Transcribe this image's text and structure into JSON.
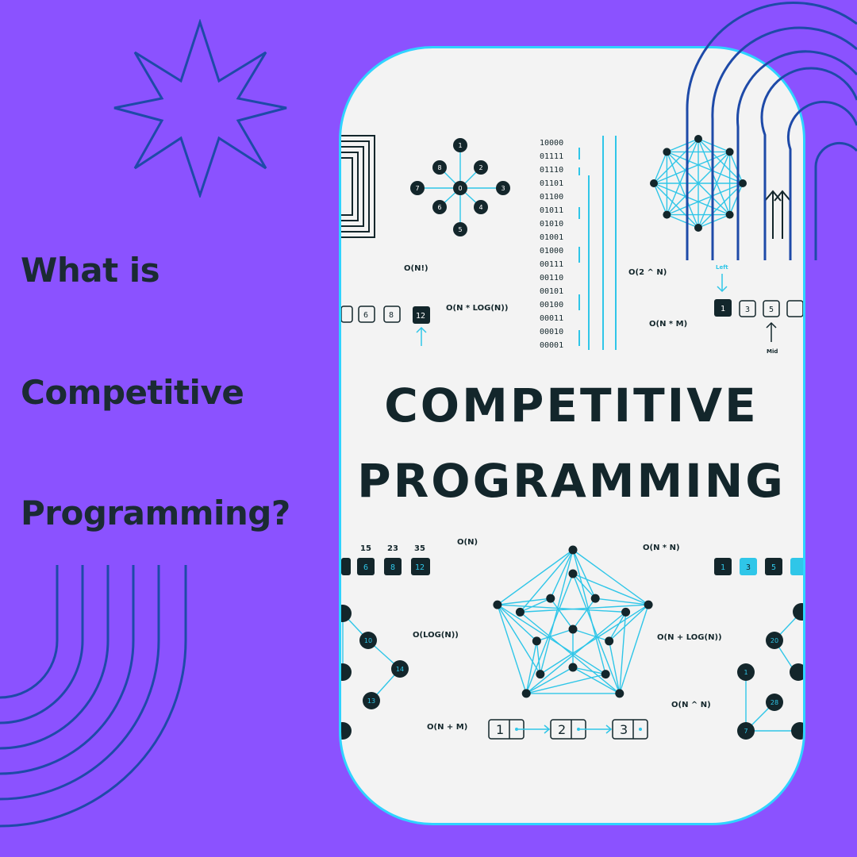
{
  "headline": {
    "line1": "What is",
    "line2": "Competitive",
    "line3": "Programming?"
  },
  "poster": {
    "title_line1": "COMPETITIVE",
    "title_line2": "PROGRAMMING",
    "complexities": {
      "n_factorial": "O(N!)",
      "n_log_n": "O(N * LOG(N))",
      "two_pow_n": "O(2 ^ N)",
      "n_times_m": "O(N * M)",
      "n": "O(N)",
      "n_times_n": "O(N * N)",
      "log_n": "O(LOG(N))",
      "n_plus_log_n": "O(N + LOG(N))",
      "n_pow_n": "O(N ^ N)",
      "n_plus_m": "O(N + M)"
    },
    "binary_rows": [
      "10000",
      "01111",
      "01110",
      "01101",
      "01100",
      "01011",
      "01010",
      "01001",
      "01000",
      "00111",
      "00110",
      "00101",
      "00100",
      "00011",
      "00010",
      "00001"
    ],
    "array_boxes_top_left": [
      "6",
      "8",
      "12"
    ],
    "array_boxes_top_right": [
      "1",
      "3",
      "5"
    ],
    "search_left_label": "Left",
    "search_mid_label": "Mid",
    "array_numbers_bottom_left": [
      "15",
      "23",
      "35"
    ],
    "array_boxes_bottom_left": [
      "6",
      "8",
      "12"
    ],
    "array_boxes_bottom_right": [
      "1",
      "3",
      "5"
    ],
    "star_graph_nodes": [
      "1",
      "8",
      "2",
      "7",
      "0",
      "3",
      "6",
      "4",
      "5"
    ],
    "tree_left_nodes": [
      "10",
      "14",
      "13"
    ],
    "tree_right_nodes": [
      "20",
      "1",
      "28",
      "7"
    ],
    "linked_list": [
      "1",
      "2",
      "3"
    ]
  },
  "colors": {
    "background": "#8b52ff",
    "headline_text": "#1b2b33",
    "deco_lines": "#1e4aa8",
    "card_border": "#2fd3ff",
    "accent_cyan": "#2fc6e8"
  }
}
